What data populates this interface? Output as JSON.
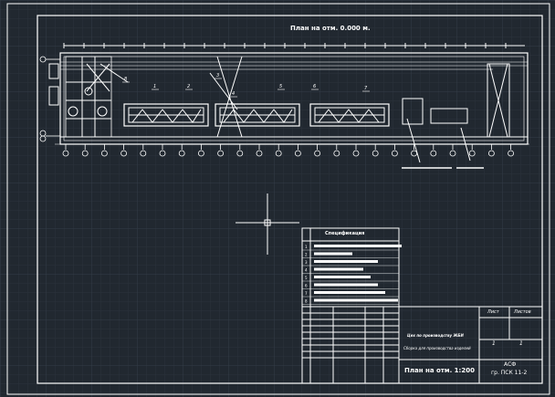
{
  "drawing": {
    "plan_title": "План на отм. 0.000 м.",
    "spec_title": "Спецификация",
    "spec_row_numbers": [
      "1",
      "2",
      "3",
      "4",
      "5",
      "6",
      "7",
      "8"
    ],
    "callouts": [
      "1",
      "2",
      "3",
      "4",
      "5",
      "6",
      "7",
      "8"
    ]
  },
  "title_block": {
    "project_line1": "Цех по производству ЖБИ",
    "project_line2": "Сборка для производства изделий",
    "sheet_header": "Лист",
    "sheets_header": "Листов",
    "sheet_value": "1",
    "sheets_value": "1",
    "sheet_title": "План на отм. 1:200",
    "org_line1": "АСФ",
    "org_line2": "гр. ПСК 11-2"
  },
  "colors": {
    "background": "#212830",
    "grid": "#2c343d",
    "lines": "#ffffff"
  }
}
